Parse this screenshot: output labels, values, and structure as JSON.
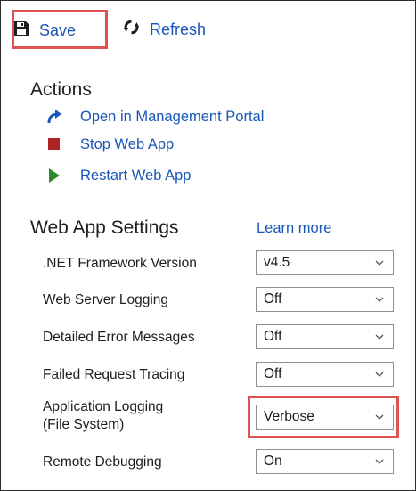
{
  "toolbar": {
    "save_label": "Save",
    "refresh_label": "Refresh"
  },
  "actions": {
    "heading": "Actions",
    "items": [
      {
        "label": "Open in Management Portal",
        "icon": "open-portal-icon"
      },
      {
        "label": "Stop Web App",
        "icon": "stop-icon"
      },
      {
        "label": "Restart Web App",
        "icon": "play-icon"
      }
    ]
  },
  "settings": {
    "heading": "Web App Settings",
    "learn_more": "Learn more",
    "rows": [
      {
        "label": ".NET Framework Version",
        "value": "v4.5"
      },
      {
        "label": "Web Server Logging",
        "value": "Off"
      },
      {
        "label": "Detailed Error Messages",
        "value": "Off"
      },
      {
        "label": "Failed Request Tracing",
        "value": "Off"
      },
      {
        "label_line1": "Application Logging",
        "label_line2": "(File System)",
        "value": "Verbose"
      },
      {
        "label": "Remote Debugging",
        "value": "On"
      }
    ]
  },
  "colors": {
    "link": "#1a56b8",
    "highlight": "#e05252",
    "stop": "#b22222",
    "play": "#2e8b2e"
  }
}
